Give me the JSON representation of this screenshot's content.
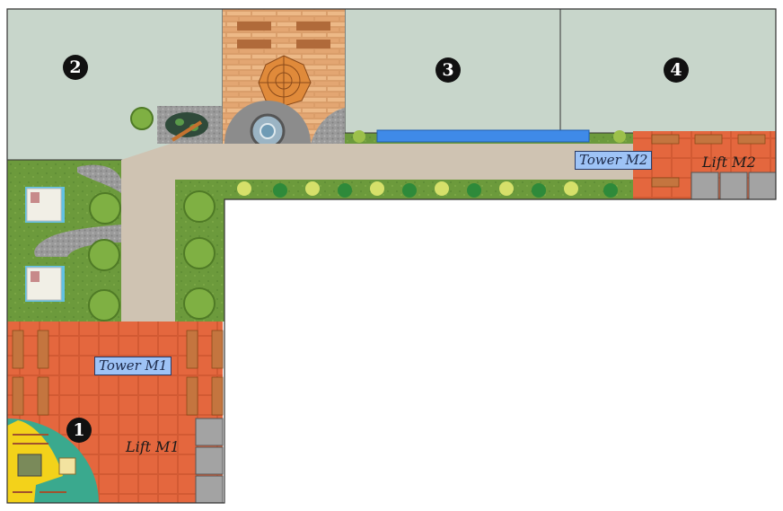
{
  "plan": {
    "zones": [
      {
        "marker": "2"
      },
      {
        "marker": "3"
      },
      {
        "marker": "4"
      },
      {
        "marker": "1"
      }
    ],
    "towers": [
      {
        "label": "Tower M1"
      },
      {
        "label": "Tower M2"
      }
    ],
    "lifts": [
      {
        "label": "Lift M1"
      },
      {
        "label": "Lift M2"
      }
    ]
  },
  "colors": {
    "building": "#c8d6cb",
    "lawn": "#6c9a3c",
    "path": "#cfc3b2",
    "tiles": "#e4673e",
    "brick": "#e9b07c",
    "playground": "#f3d21a",
    "play_area": "#3aa98e",
    "water": "#3f8ae8",
    "lift": "#a3a3a3",
    "outline": "#333333"
  },
  "icons": [
    "gazebo-icon",
    "fountain-icon",
    "pond-icon",
    "bench-icon",
    "tree-icon",
    "shrub-icon",
    "sunbed-icon",
    "swing-icon"
  ]
}
